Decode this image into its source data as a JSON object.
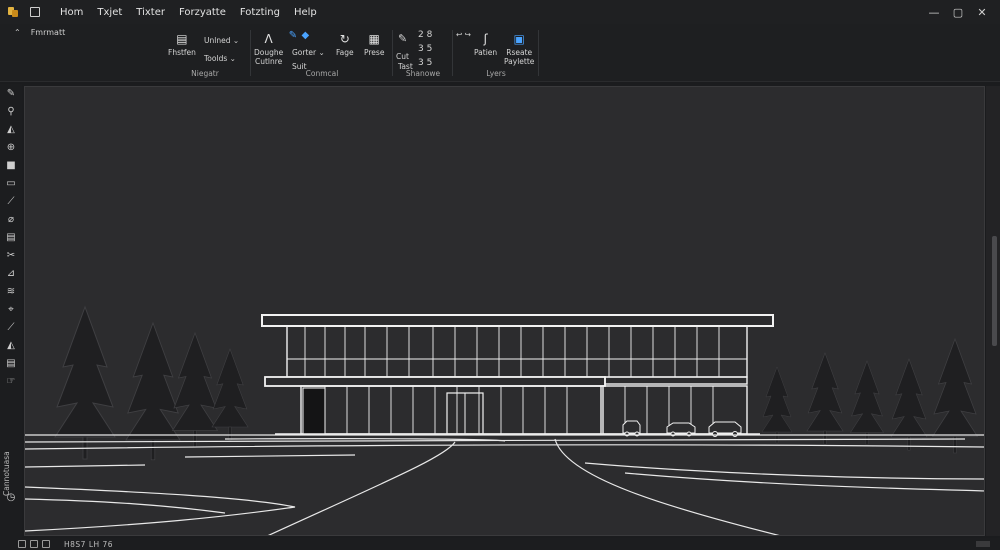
{
  "menu": [
    "Hom",
    "Txjet",
    "Tixter",
    "Forzyatte",
    "Fotzting",
    "Help"
  ],
  "ribbon": {
    "tab_label": "Fmrmatt",
    "groups": {
      "navigate": {
        "label": "Niegatr",
        "finished_label": "Fhstfen",
        "unlinked_label": "Unlned",
        "toolds_label": "Toolds"
      },
      "control": {
        "label": "Conmcal",
        "double_label": "Doughe",
        "outline_label": "Cutlnre",
        "gorter_label": "Gorter",
        "suit_label": "Suit",
        "fage_label": "Fage",
        "prese_label": "Prese"
      },
      "shadow": {
        "label": "Shanowe",
        "cut_label": "Cut",
        "tast_label": "Tast",
        "num_top": "2 8",
        "num_mid": "3 5",
        "num_bot": "3 5"
      },
      "lyers": {
        "label": "Lyers",
        "patien_label": "Patien",
        "relate_label": "Rseate",
        "paylette_label": "Paylette"
      }
    }
  },
  "left_panel_label": "Cannotuasa",
  "status": {
    "coords": "H8S7   LH 76"
  },
  "icons": {
    "app": "app-logo-icon",
    "save": "save-icon",
    "minimize": "minimize-icon",
    "maximize": "maximize-icon",
    "close": "close-icon"
  },
  "colors": {
    "canvas_bg": "#2c2c2e",
    "line_white": "#f2f2f2",
    "accent_blue": "#4aa3ff"
  }
}
